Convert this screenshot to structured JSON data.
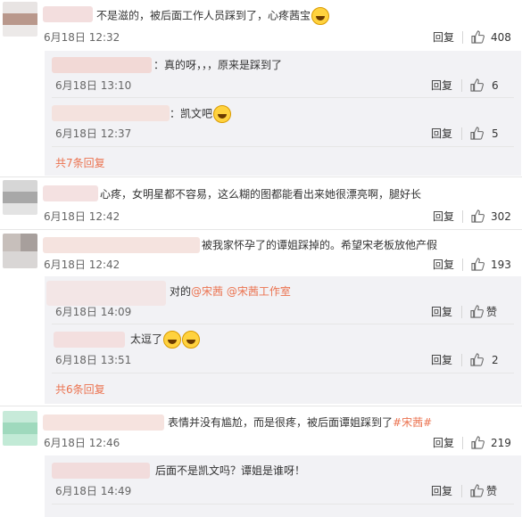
{
  "comments": [
    {
      "text": "不是滋的，被后面工作人员踩到了，心疼茜宝",
      "date": "6月18日 12:32",
      "reply": "回复",
      "likes": "408"
    },
    {
      "text": "心疼，女明星都不容易，这么糊的图都能看出来她很漂亮啊，腿好长",
      "date": "6月18日 12:42",
      "reply": "回复",
      "likes": "302"
    },
    {
      "text": "被我家怀孕了的谭姐踩掉的。希望宋老板放他产假",
      "date": "6月18日 12:42",
      "reply": "回复",
      "likes": "193"
    },
    {
      "text": "表情并没有尴尬，而是很疼，被后面谭姐踩到了",
      "tag": "#宋茜#",
      "date": "6月18日 12:46",
      "reply": "回复",
      "likes": "219"
    }
  ],
  "subreplies_1": [
    {
      "text": "：真的呀，，，原来是踩到了",
      "date": "6月18日 13:10",
      "reply": "回复",
      "likes": "6"
    },
    {
      "text": "：凯文吧",
      "date": "6月18日 12:37",
      "reply": "回复",
      "likes": "5"
    }
  ],
  "more_1": "共7条回复",
  "subreplies_3": [
    {
      "text": "对的",
      "mention1": "@宋茜",
      "mention2": "@宋茜工作室",
      "date": "6月18日 14:09",
      "reply": "回复",
      "likes": "赞"
    },
    {
      "text": "太逗了",
      "date": "6月18日 13:51",
      "reply": "回复",
      "likes": "2"
    }
  ],
  "more_3": "共6条回复",
  "subreplies_4": [
    {
      "text": "后面不是凯文吗？谭姐是谁呀！",
      "date": "6月18日 14:49",
      "reply": "回复",
      "likes": "赞"
    }
  ],
  "icons": {
    "like": "thumbs-up-icon",
    "emoji_sad": "sad-face-emoji-icon",
    "emoji_laugh": "laughing-emoji-icon",
    "emoji_cool": "smirk-emoji-icon"
  },
  "colors": {
    "link": "#eb7350",
    "subbox": "#f2f2f5",
    "text": "#333333",
    "meta": "#666666"
  }
}
